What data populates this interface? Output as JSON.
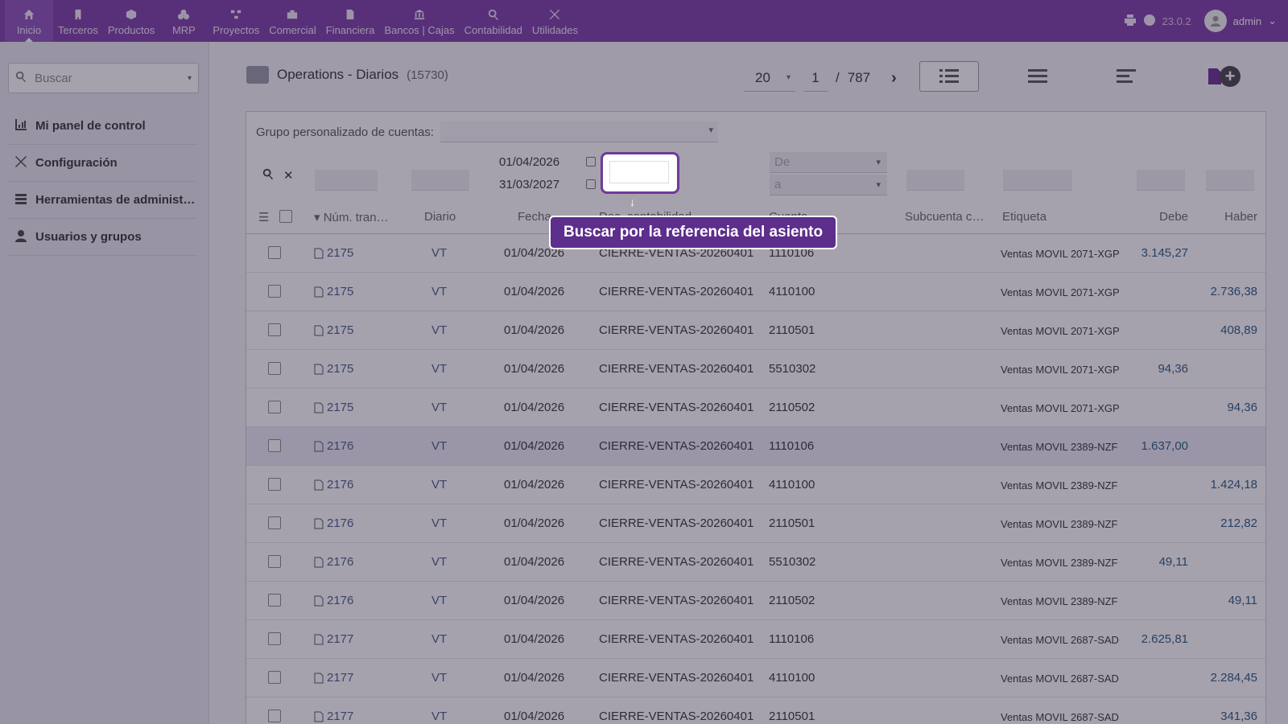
{
  "topbar": {
    "menu": [
      {
        "label": "Inicio",
        "icon": "home-icon",
        "active": true
      },
      {
        "label": "Terceros",
        "icon": "building-icon"
      },
      {
        "label": "Productos",
        "icon": "cube-icon"
      },
      {
        "label": "MRP",
        "icon": "cubes-icon"
      },
      {
        "label": "Proyectos",
        "icon": "sitemap-icon"
      },
      {
        "label": "Comercial",
        "icon": "suitcase-icon"
      },
      {
        "label": "Financiera",
        "icon": "invoice-icon"
      },
      {
        "label": "Bancos | Cajas",
        "icon": "bank-icon"
      },
      {
        "label": "Contabilidad",
        "icon": "search-dollar-icon"
      },
      {
        "label": "Utilidades",
        "icon": "tools-icon"
      }
    ],
    "version": "23.0.2",
    "user": "admin"
  },
  "sidebar": {
    "search_placeholder": "Buscar",
    "items": [
      {
        "label": "Mi panel de control",
        "icon": "chart-icon"
      },
      {
        "label": "Configuración",
        "icon": "tools-icon"
      },
      {
        "label": "Herramientas de administ…",
        "icon": "server-icon"
      },
      {
        "label": "Usuarios y grupos",
        "icon": "user-icon"
      }
    ]
  },
  "header": {
    "title": "Operations - Diarios",
    "count": "(15730)",
    "limit": "20",
    "page": "1",
    "separator": "/",
    "total_pages": "787"
  },
  "filters": {
    "group_label": "Grupo personalizado de cuentas:",
    "date_from": "01/04/2026",
    "date_to": "31/03/2027",
    "account_from_placeholder": "De",
    "account_to_placeholder": "a"
  },
  "columns": {
    "ref": "Núm. tran…",
    "diario": "Diario",
    "fecha": "Fecha",
    "doc": "Doc. contabilidad",
    "cuenta": "Cuenta",
    "subcuenta": "Subcuenta c…",
    "etiqueta": "Etiqueta",
    "debe": "Debe",
    "haber": "Haber"
  },
  "rows": [
    {
      "ref": "2175",
      "diario": "VT",
      "fecha": "01/04/2026",
      "doc": "CIERRE-VENTAS-20260401",
      "cuenta": "1110106",
      "etiqueta": "Ventas MOVIL 2071-XGP",
      "debe": "3.145,27",
      "haber": ""
    },
    {
      "ref": "2175",
      "diario": "VT",
      "fecha": "01/04/2026",
      "doc": "CIERRE-VENTAS-20260401",
      "cuenta": "4110100",
      "etiqueta": "Ventas MOVIL 2071-XGP",
      "debe": "",
      "haber": "2.736,38"
    },
    {
      "ref": "2175",
      "diario": "VT",
      "fecha": "01/04/2026",
      "doc": "CIERRE-VENTAS-20260401",
      "cuenta": "2110501",
      "etiqueta": "Ventas MOVIL 2071-XGP",
      "debe": "",
      "haber": "408,89"
    },
    {
      "ref": "2175",
      "diario": "VT",
      "fecha": "01/04/2026",
      "doc": "CIERRE-VENTAS-20260401",
      "cuenta": "5510302",
      "etiqueta": "Ventas MOVIL 2071-XGP",
      "debe": "94,36",
      "haber": ""
    },
    {
      "ref": "2175",
      "diario": "VT",
      "fecha": "01/04/2026",
      "doc": "CIERRE-VENTAS-20260401",
      "cuenta": "2110502",
      "etiqueta": "Ventas MOVIL 2071-XGP",
      "debe": "",
      "haber": "94,36"
    },
    {
      "ref": "2176",
      "diario": "VT",
      "fecha": "01/04/2026",
      "doc": "CIERRE-VENTAS-20260401",
      "cuenta": "1110106",
      "etiqueta": "Ventas MOVIL 2389-NZF",
      "debe": "1.637,00",
      "haber": ""
    },
    {
      "ref": "2176",
      "diario": "VT",
      "fecha": "01/04/2026",
      "doc": "CIERRE-VENTAS-20260401",
      "cuenta": "4110100",
      "etiqueta": "Ventas MOVIL 2389-NZF",
      "debe": "",
      "haber": "1.424,18"
    },
    {
      "ref": "2176",
      "diario": "VT",
      "fecha": "01/04/2026",
      "doc": "CIERRE-VENTAS-20260401",
      "cuenta": "2110501",
      "etiqueta": "Ventas MOVIL 2389-NZF",
      "debe": "",
      "haber": "212,82"
    },
    {
      "ref": "2176",
      "diario": "VT",
      "fecha": "01/04/2026",
      "doc": "CIERRE-VENTAS-20260401",
      "cuenta": "5510302",
      "etiqueta": "Ventas MOVIL 2389-NZF",
      "debe": "49,11",
      "haber": ""
    },
    {
      "ref": "2176",
      "diario": "VT",
      "fecha": "01/04/2026",
      "doc": "CIERRE-VENTAS-20260401",
      "cuenta": "2110502",
      "etiqueta": "Ventas MOVIL 2389-NZF",
      "debe": "",
      "haber": "49,11"
    },
    {
      "ref": "2177",
      "diario": "VT",
      "fecha": "01/04/2026",
      "doc": "CIERRE-VENTAS-20260401",
      "cuenta": "1110106",
      "etiqueta": "Ventas MOVIL 2687-SAD",
      "debe": "2.625,81",
      "haber": ""
    },
    {
      "ref": "2177",
      "diario": "VT",
      "fecha": "01/04/2026",
      "doc": "CIERRE-VENTAS-20260401",
      "cuenta": "4110100",
      "etiqueta": "Ventas MOVIL 2687-SAD",
      "debe": "",
      "haber": "2.284,45"
    },
    {
      "ref": "2177",
      "diario": "VT",
      "fecha": "01/04/2026",
      "doc": "CIERRE-VENTAS-20260401",
      "cuenta": "2110501",
      "etiqueta": "Ventas MOVIL 2687-SAD",
      "debe": "",
      "haber": "341,36"
    }
  ],
  "tour": {
    "tooltip": "Buscar por la referencia del asiento"
  },
  "colors": {
    "topbar": "#7a3da8",
    "tooltip": "#5d2e8c",
    "amount": "#2a5a80"
  }
}
